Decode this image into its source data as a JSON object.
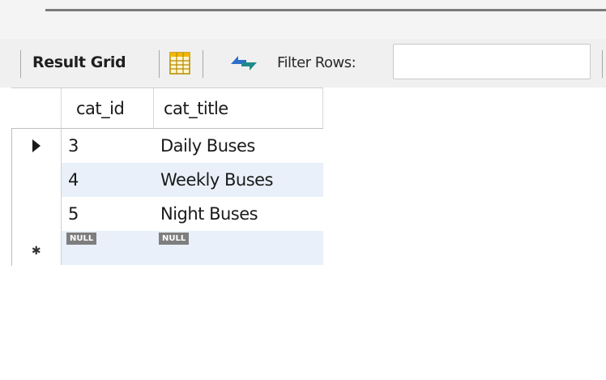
{
  "toolbar": {
    "result_grid_label": "Result Grid",
    "filter_rows_label": "Filter Rows:",
    "filter_value": "",
    "grid_icon": "grid-layout-icon",
    "refresh_icon": "refresh-arrows-icon"
  },
  "grid": {
    "columns": [
      "cat_id",
      "cat_title"
    ],
    "rows": [
      {
        "cat_id": "3",
        "cat_title": "Daily Buses"
      },
      {
        "cat_id": "4",
        "cat_title": "Weekly Buses"
      },
      {
        "cat_id": "5",
        "cat_title": "Night Buses"
      }
    ],
    "new_row": {
      "cat_id": "NULL",
      "cat_title": "NULL"
    }
  },
  "colors": {
    "selected_row_bg": "#eaf0f9",
    "null_badge_bg": "#7e7e7e",
    "grid_icon_accent": "#f2b705",
    "refresh_icon_accent": "#2a6fc9"
  }
}
